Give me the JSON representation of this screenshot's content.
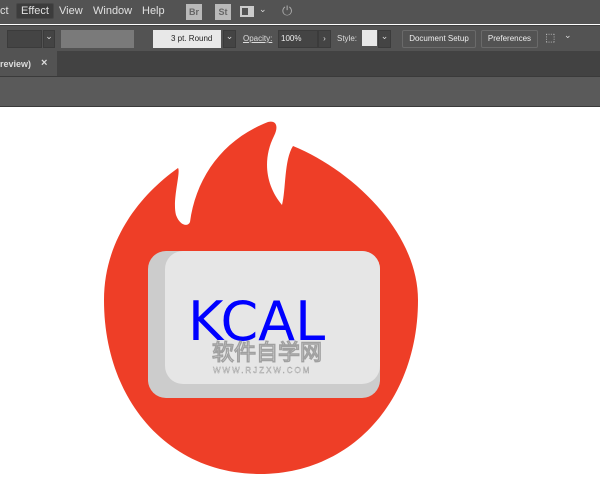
{
  "menu": {
    "items": [
      "ct",
      "Effect",
      "View",
      "Window",
      "Help"
    ],
    "bridge": "Br",
    "stock": "St"
  },
  "toolbar": {
    "stroke_profile": "3 pt. Round",
    "opacity_label": "Opacity:",
    "opacity_value": "100%",
    "style_label": "Style:",
    "document_setup": "Document Setup",
    "preferences": "Preferences"
  },
  "tab": {
    "label": "review)",
    "close": "×"
  },
  "artwork": {
    "text": "KCAL",
    "watermark_cn": "软件自学网",
    "watermark_url": "WWW.RJZXW.COM"
  },
  "colors": {
    "flame": "#ee3e27",
    "key_face": "#e6e6e6",
    "key_shadow": "#cccccc",
    "text": "#0000ff"
  }
}
